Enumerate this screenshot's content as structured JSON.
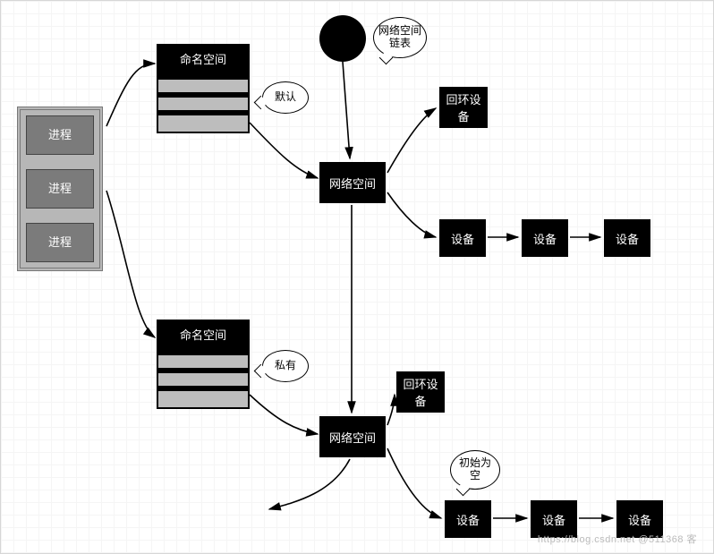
{
  "processes": [
    "进程",
    "进程",
    "进程"
  ],
  "namespace_label": "命名空间",
  "default_bubble": "默认",
  "private_bubble": "私有",
  "netspace_label": "网络空间",
  "netspace_list_bubble": "网络空间链表",
  "loopback_label": "回环设备",
  "device_label": "设备",
  "init_empty_bubble": "初始为空",
  "watermark": "https://blog.csdn.net @511368 客"
}
